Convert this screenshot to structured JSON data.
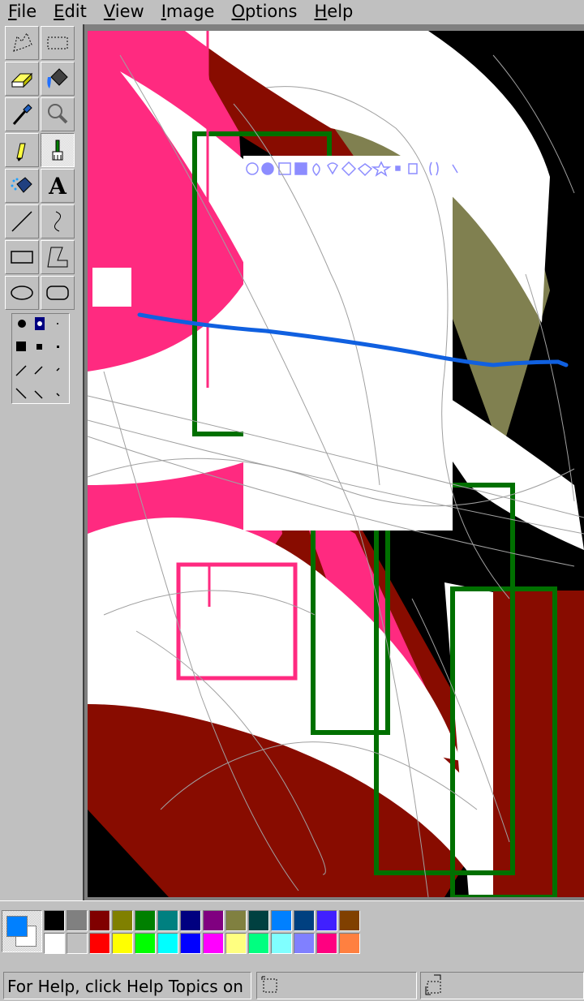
{
  "menu": {
    "file": {
      "key": "F",
      "rest": "ile"
    },
    "edit": {
      "key": "E",
      "rest": "dit"
    },
    "view": {
      "key": "V",
      "rest": "iew"
    },
    "image": {
      "key": "I",
      "rest": "mage"
    },
    "options": {
      "key": "O",
      "rest": "ptions"
    },
    "help": {
      "key": "H",
      "rest": "elp"
    }
  },
  "tools": [
    "free-form-select-icon",
    "select-icon",
    "eraser-icon",
    "fill-with-color-icon",
    "pick-color-icon",
    "magnifier-icon",
    "pencil-icon",
    "brush-icon",
    "airbrush-icon",
    "text-icon",
    "line-icon",
    "curve-icon",
    "rectangle-icon",
    "polygon-icon",
    "ellipse-icon",
    "rounded-rectangle-icon"
  ],
  "active_tool": "brush-icon",
  "text_tool_glyph": "A",
  "colors": {
    "foreground": "#0080ff",
    "background": "#ffffff",
    "palette_top": [
      "#000000",
      "#808080",
      "#800000",
      "#808000",
      "#008000",
      "#008080",
      "#000080",
      "#800080",
      "#808040",
      "#004040",
      "#0080ff",
      "#004080",
      "#4020ff",
      "#804000"
    ],
    "palette_bottom": [
      "#ffffff",
      "#c0c0c0",
      "#ff0000",
      "#ffff00",
      "#00ff00",
      "#00ffff",
      "#0000ff",
      "#ff00ff",
      "#ffff80",
      "#00ff80",
      "#80ffff",
      "#8080ff",
      "#ff0080",
      "#ff8040"
    ]
  },
  "status": {
    "help_text": "For Help, click Help Topics on"
  }
}
